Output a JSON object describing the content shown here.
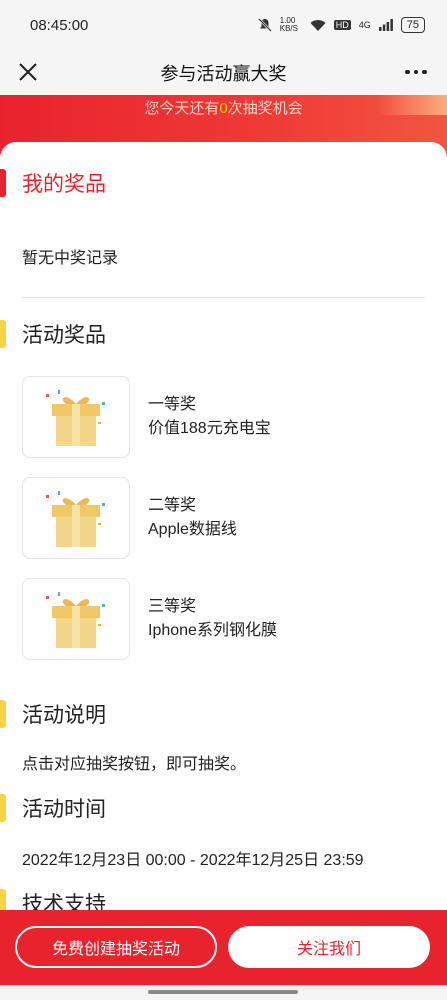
{
  "status_bar": {
    "time": "08:45:00",
    "net_speed": "1.00 KB/S",
    "hd": "HD",
    "signal": "4G",
    "battery": "75"
  },
  "nav": {
    "title": "参与活动赢大奖"
  },
  "banner": {
    "prefix": "您今天还有",
    "count": "0",
    "suffix": "次抽奖机会"
  },
  "my_prizes": {
    "title": "我的奖品",
    "empty_text": "暂无中奖记录"
  },
  "activity_prizes": {
    "title": "活动奖品",
    "items": [
      {
        "tier": "一等奖",
        "desc": "价值188元充电宝"
      },
      {
        "tier": "二等奖",
        "desc": "Apple数据线"
      },
      {
        "tier": "三等奖",
        "desc": "Iphone系列钢化膜"
      }
    ]
  },
  "description": {
    "title": "活动说明",
    "text": "点击对应抽奖按钮，即可抽奖。"
  },
  "time": {
    "title": "活动时间",
    "text": "2022年12月23日 00:00 - 2022年12月25日 23:59"
  },
  "support": {
    "title": "技术支持"
  },
  "bottom": {
    "create_label": "免费创建抽奖活动",
    "follow_label": "关注我们"
  },
  "colors": {
    "primary_red": "#e8232d",
    "accent_yellow": "#f8d34a"
  }
}
